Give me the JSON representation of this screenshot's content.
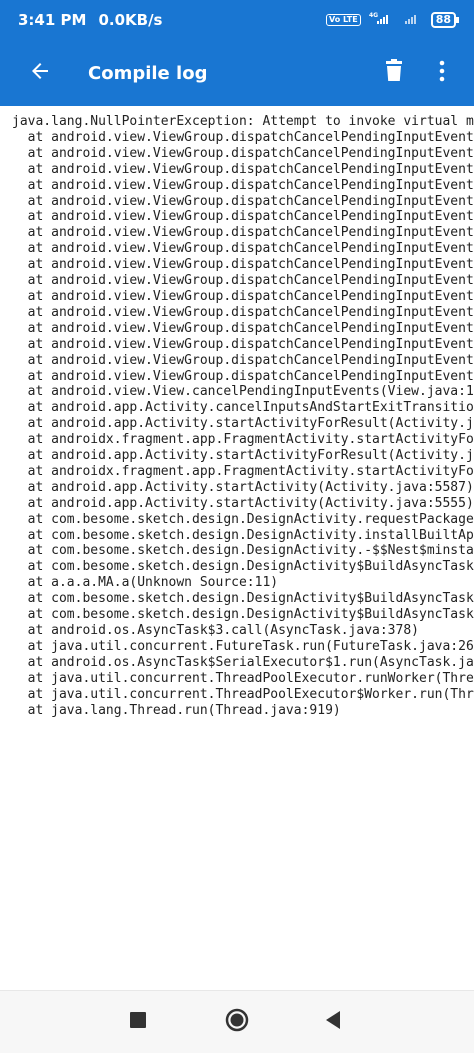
{
  "status_bar": {
    "time": "3:41 PM",
    "speed": "0.0KB/s",
    "volte": "Vo LTE",
    "network": "4G",
    "battery": "88"
  },
  "app_bar": {
    "title": "Compile log",
    "back_icon": "arrow-back-icon",
    "delete_icon": "trash-icon",
    "more_icon": "more-vert-icon",
    "color": "#1976d2"
  },
  "log": {
    "lines": [
      "java.lang.NullPointerException: Attempt to invoke virtual m",
      "  at android.view.ViewGroup.dispatchCancelPendingInputEvent",
      "  at android.view.ViewGroup.dispatchCancelPendingInputEvent",
      "  at android.view.ViewGroup.dispatchCancelPendingInputEvent",
      "  at android.view.ViewGroup.dispatchCancelPendingInputEvent",
      "  at android.view.ViewGroup.dispatchCancelPendingInputEvent",
      "  at android.view.ViewGroup.dispatchCancelPendingInputEvent",
      "  at android.view.ViewGroup.dispatchCancelPendingInputEvent",
      "  at android.view.ViewGroup.dispatchCancelPendingInputEvent",
      "  at android.view.ViewGroup.dispatchCancelPendingInputEvent",
      "  at android.view.ViewGroup.dispatchCancelPendingInputEvent",
      "  at android.view.ViewGroup.dispatchCancelPendingInputEvent",
      "  at android.view.ViewGroup.dispatchCancelPendingInputEvent",
      "  at android.view.ViewGroup.dispatchCancelPendingInputEvent",
      "  at android.view.ViewGroup.dispatchCancelPendingInputEvent",
      "  at android.view.ViewGroup.dispatchCancelPendingInputEvent",
      "  at android.view.ViewGroup.dispatchCancelPendingInputEvent",
      "  at android.view.View.cancelPendingInputEvents(View.java:1",
      "  at android.app.Activity.cancelInputsAndStartExitTransitio",
      "  at android.app.Activity.startActivityForResult(Activity.j",
      "  at androidx.fragment.app.FragmentActivity.startActivityFo",
      "  at android.app.Activity.startActivityForResult(Activity.j",
      "  at androidx.fragment.app.FragmentActivity.startActivityFo",
      "  at android.app.Activity.startActivity(Activity.java:5587)",
      "  at android.app.Activity.startActivity(Activity.java:5555)",
      "  at com.besome.sketch.design.DesignActivity.requestPackage",
      "  at com.besome.sketch.design.DesignActivity.installBuiltAp",
      "  at com.besome.sketch.design.DesignActivity.-$$Nest$minsta",
      "  at com.besome.sketch.design.DesignActivity$BuildAsyncTask",
      "  at a.a.a.MA.a(Unknown Source:11)",
      "  at com.besome.sketch.design.DesignActivity$BuildAsyncTask",
      "  at com.besome.sketch.design.DesignActivity$BuildAsyncTask",
      "  at android.os.AsyncTask$3.call(AsyncTask.java:378)",
      "  at java.util.concurrent.FutureTask.run(FutureTask.java:26",
      "  at android.os.AsyncTask$SerialExecutor$1.run(AsyncTask.ja",
      "  at java.util.concurrent.ThreadPoolExecutor.runWorker(Thre",
      "  at java.util.concurrent.ThreadPoolExecutor$Worker.run(Thr",
      "  at java.lang.Thread.run(Thread.java:919)"
    ]
  },
  "nav_bar": {
    "recents_icon": "square-recents-icon",
    "home_icon": "circle-home-icon",
    "back_icon": "triangle-back-icon"
  }
}
